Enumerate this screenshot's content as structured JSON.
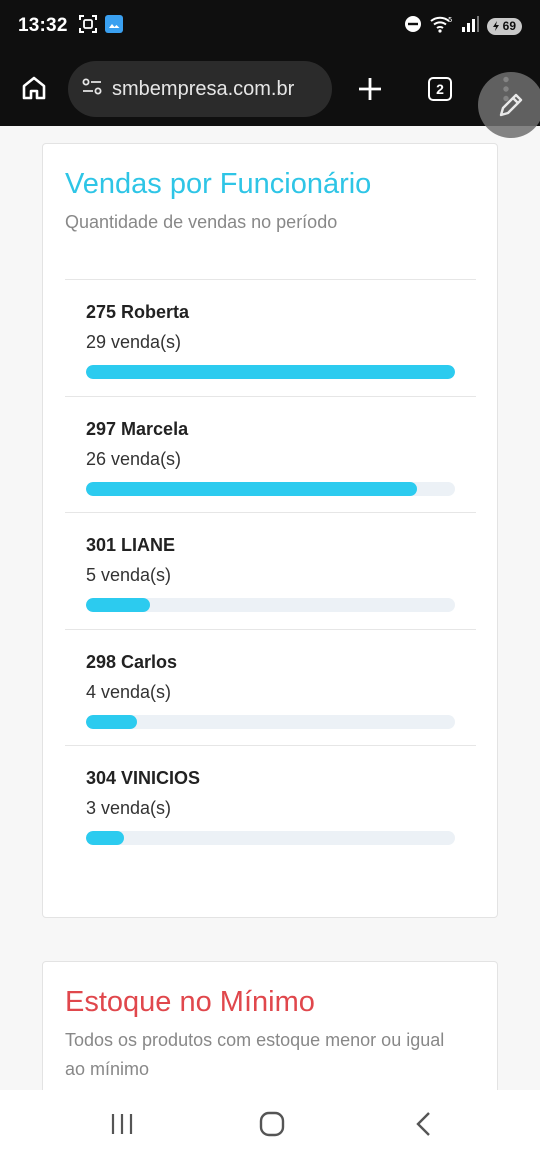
{
  "status_bar": {
    "time": "13:32",
    "battery": "69",
    "icons": [
      "screenshot-icon",
      "gallery-icon",
      "do-not-disturb-icon",
      "wifi-icon",
      "signal-icon",
      "battery-icon"
    ]
  },
  "browser": {
    "url": "smbempresa.com.br",
    "tab_count": "2",
    "icons": [
      "home-icon",
      "site-info-icon",
      "plus-icon",
      "tabs-icon",
      "more-vert-icon",
      "edit-pencil-icon"
    ]
  },
  "sales_card": {
    "title": "Vendas por Funcionário",
    "subtitle": "Quantidade de vendas no período",
    "rows": [
      {
        "name": "275 Roberta",
        "count_label": "29 venda(s)",
        "value": 29
      },
      {
        "name": "297 Marcela",
        "count_label": "26 venda(s)",
        "value": 26
      },
      {
        "name": "301 LIANE",
        "count_label": "5 venda(s)",
        "value": 5
      },
      {
        "name": "298 Carlos",
        "count_label": "4 venda(s)",
        "value": 4
      },
      {
        "name": "304 VINICIOS",
        "count_label": "3 venda(s)",
        "value": 3
      }
    ]
  },
  "stock_card": {
    "title": "Estoque no Mínimo",
    "subtitle": "Todos os produtos com estoque menor ou igual ao mínimo"
  },
  "nav_bar": {
    "icons": [
      "recent-apps-icon",
      "home-circle-icon",
      "back-icon"
    ]
  },
  "colors": {
    "accent": "#2ccbef",
    "sales_title": "#2ec5e6",
    "stock_title": "#e0474c",
    "toolbar_bg": "#0f0f0f"
  }
}
